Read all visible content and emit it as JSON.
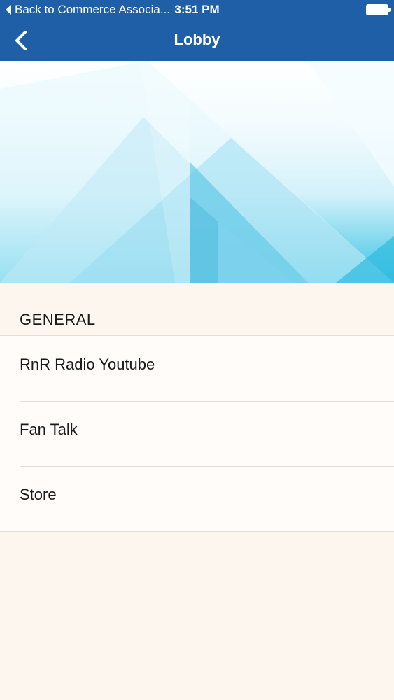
{
  "status_bar": {
    "back_app_label": "Back to Commerce Associa...",
    "time": "3:51 PM",
    "battery_level": 1.0
  },
  "nav": {
    "title": "Lobby",
    "back_icon": "chevron-left-icon"
  },
  "colors": {
    "nav_background": "#1e5fa8",
    "page_background": "#fdf6ef",
    "hero_accent": "#39c3e3"
  },
  "section": {
    "header": "GENERAL",
    "items": [
      {
        "label": "RnR Radio Youtube"
      },
      {
        "label": "Fan Talk"
      },
      {
        "label": "Store"
      }
    ]
  }
}
